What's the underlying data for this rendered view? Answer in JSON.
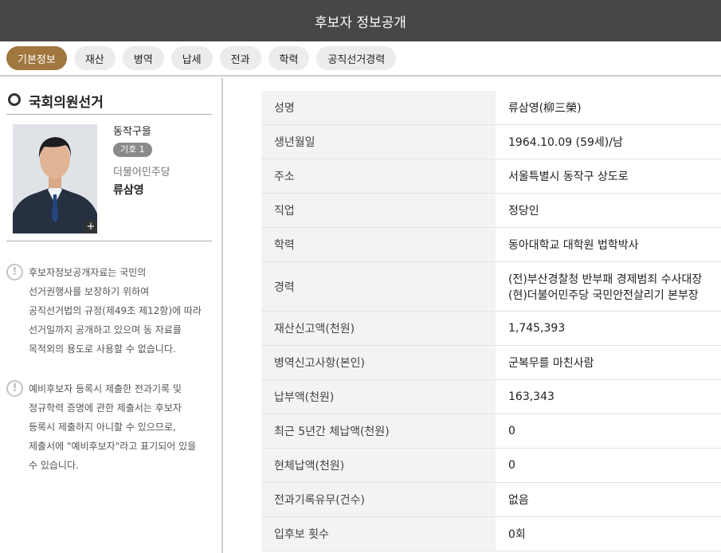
{
  "window": {
    "title": "후보자 정보공개"
  },
  "tabs": [
    {
      "label": "기본정보",
      "active": true
    },
    {
      "label": "재산",
      "active": false
    },
    {
      "label": "병역",
      "active": false
    },
    {
      "label": "납세",
      "active": false
    },
    {
      "label": "전과",
      "active": false
    },
    {
      "label": "학력",
      "active": false
    },
    {
      "label": "공직선거경력",
      "active": false
    }
  ],
  "sidebar": {
    "election_title": "국회의원선거",
    "candidate": {
      "district": "동작구을",
      "number_badge": "기호 1",
      "party": "더불어민주당",
      "name": "류삼영",
      "photo_expand_glyph": "+"
    },
    "notices": [
      {
        "icon": "!",
        "lines": [
          "후보자정보공개자료는 국민의",
          "선거권행사를 보장하기 위하여",
          "공직선거법의 규정(제49조 제12항)에 따라",
          "선거일까지 공개하고 있으며 동 자료를",
          "목적외의 용도로 사용할 수 없습니다."
        ]
      },
      {
        "icon": "!",
        "lines": [
          "예비후보자 등록시 제출한 전과기록 및",
          "정규학력 증명에 관한 제출서는 후보자",
          "등록시 제출하지 아니할 수 있으므로,",
          "제출서에 \"예비후보자\"라고 표기되어 있을",
          "수 있습니다."
        ]
      }
    ]
  },
  "info_table": {
    "rows": [
      {
        "label": "성명",
        "value": [
          "류삼영(柳三榮)"
        ]
      },
      {
        "label": "생년월일",
        "value": [
          "1964.10.09 (59세)/남"
        ]
      },
      {
        "label": "주소",
        "value": [
          "서울특별시 동작구 상도로"
        ]
      },
      {
        "label": "직업",
        "value": [
          "정당인"
        ]
      },
      {
        "label": "학력",
        "value": [
          "동아대학교 대학원 법학박사"
        ]
      },
      {
        "label": "경력",
        "value": [
          "(전)부산경찰청 반부패 경제범죄 수사대장",
          "(현)더불어민주당 국민안전살리기 본부장"
        ]
      },
      {
        "label": "재산신고액(천원)",
        "value": [
          "1,745,393"
        ]
      },
      {
        "label": "병역신고사항(본인)",
        "value": [
          "군복무를 마친사람"
        ]
      },
      {
        "label": "납부액(천원)",
        "value": [
          "163,343"
        ]
      },
      {
        "label": "최근 5년간 체납액(천원)",
        "value": [
          "0"
        ]
      },
      {
        "label": "현체납액(천원)",
        "value": [
          "0"
        ]
      },
      {
        "label": "전과기록유무(건수)",
        "value": [
          "없음"
        ]
      },
      {
        "label": "입후보 횟수",
        "value": [
          "0회"
        ]
      }
    ]
  },
  "colors": {
    "title_bar": "#474747",
    "tab_active": "#a0773f",
    "tab_inactive": "#ececec",
    "label_bg": "#f3f3f3"
  }
}
